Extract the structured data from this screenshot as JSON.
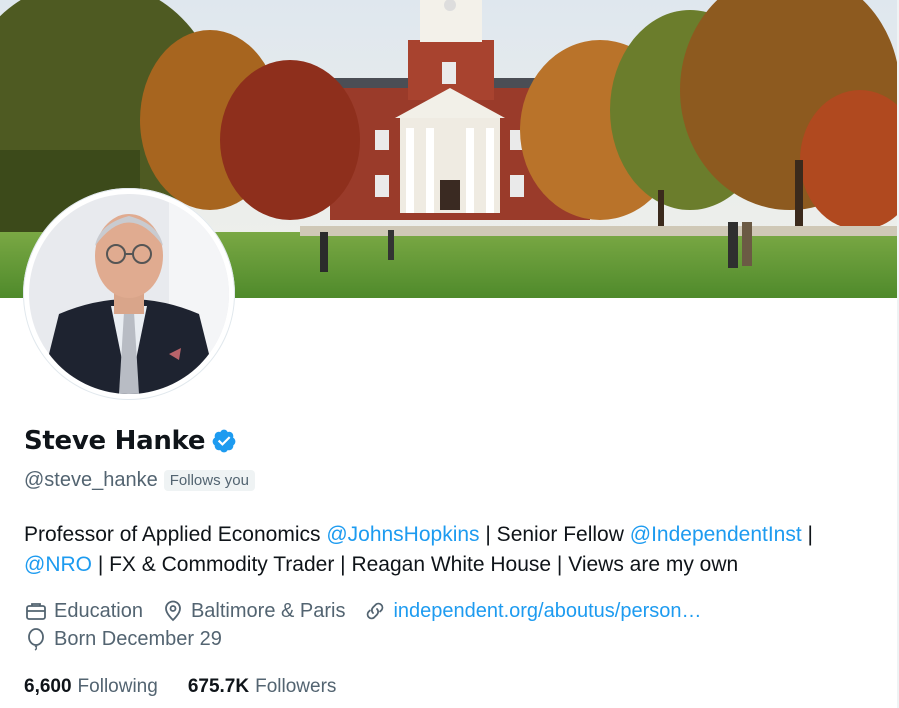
{
  "profile": {
    "name": "Steve Hanke",
    "handle": "@steve_hanke",
    "follows_you": "Follows you",
    "verified": true
  },
  "bio": {
    "part1": "Professor of Applied Economics ",
    "mention1": "@JohnsHopkins",
    "part2": " | Senior Fellow ",
    "mention2": "@IndependentInst",
    "part3": " |",
    "mention3": "@NRO",
    "part4": " | FX & Commodity Trader | Reagan White House | Views are my own"
  },
  "meta": {
    "category": "Education",
    "location": "Baltimore & Paris",
    "website": "independent.org/aboutus/person…",
    "born": "Born December 29"
  },
  "stats": {
    "following_count": "6,600",
    "following_label": "Following",
    "followers_count": "675.7K",
    "followers_label": "Followers"
  },
  "icons": {
    "category": "briefcase-icon",
    "location": "location-pin-icon",
    "website": "link-icon",
    "born": "balloon-icon",
    "verified": "verified-badge-icon"
  },
  "colors": {
    "accent": "#1d9bf0",
    "secondary_text": "#536471",
    "primary_text": "#0f1419"
  }
}
